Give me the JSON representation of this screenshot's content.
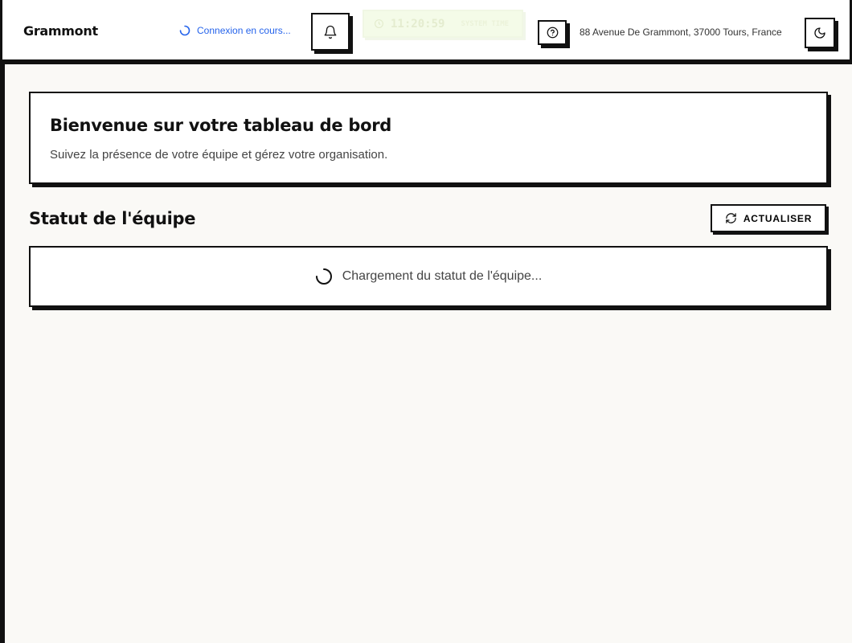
{
  "header": {
    "brand": "Grammont",
    "connection_status": "Connexion en cours...",
    "clock": {
      "time": "11:20:59",
      "label": "SYSTEM TIME"
    },
    "address": "88 Avenue De Grammont, 37000 Tours, France",
    "icons": {
      "notifications": "bell-icon",
      "help": "question-circle-icon",
      "theme": "moon-icon",
      "connection": "spinner-icon",
      "clock": "clock-icon"
    }
  },
  "welcome": {
    "title": "Bienvenue sur votre tableau de bord",
    "subtitle": "Suivez la présence de votre équipe et gérez votre organisation."
  },
  "team_status": {
    "title": "Statut de l'équipe",
    "refresh_label": "ACTUALISER",
    "refresh_icon": "refresh-icon",
    "loading_text": "Chargement du statut de l'équipe...",
    "loading_icon": "spinner-icon"
  },
  "colors": {
    "accent_blue": "#2563eb",
    "border": "#111111",
    "background": "#faf9f6",
    "clock_bg": "#f4fbe8"
  }
}
